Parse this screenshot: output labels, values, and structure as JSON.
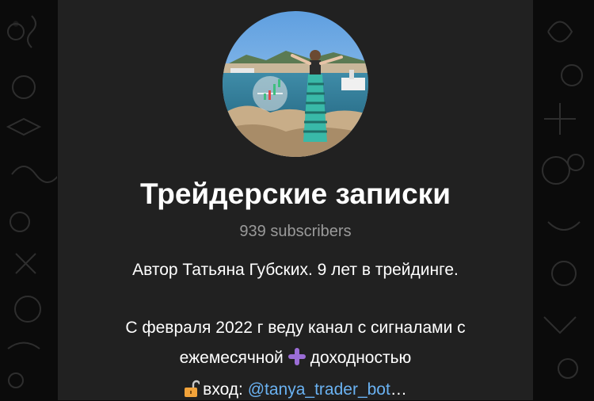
{
  "channel": {
    "title": "Трейдерские записки",
    "subscribers": "939 subscribers",
    "description": {
      "line1": "Автор Татьяна Губских. 9 лет в трейдинге.",
      "line2": "С февраля 2022 г веду канал с сигналами с",
      "line3_before": "ежемесячной",
      "line3_after": "доходностью",
      "line4_prefix": "вход: ",
      "line4_link": "@tanya_trader_bot",
      "line4_suffix": "…"
    }
  },
  "icons": {
    "avatar": "channel-avatar-photo",
    "plus": "heavy-plus-emoji",
    "lock": "open-lock-emoji"
  },
  "colors": {
    "card_bg": "#212121",
    "page_bg": "#0b0b0b",
    "title": "#ffffff",
    "muted": "#9a9a9a",
    "link": "#6ab2f2",
    "plus_emoji": "#9b6dd6"
  }
}
